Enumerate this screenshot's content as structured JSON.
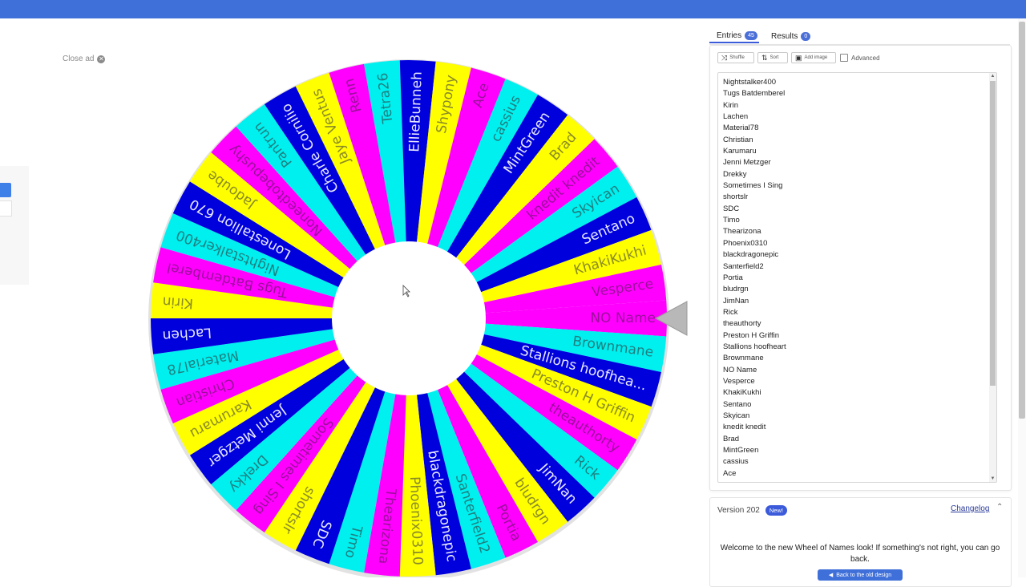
{
  "close_ad": "Close ad",
  "tabs": {
    "entries_label": "Entries",
    "entries_count": "45",
    "results_label": "Results",
    "results_count": "0"
  },
  "toolbar": {
    "shuffle": "Shuffle",
    "sort": "Sort",
    "add_image": "Add image",
    "advanced": "Advanced"
  },
  "entries": [
    "Nightstalker400",
    "Tugs Batdemberel",
    "Kirin",
    "Lachen",
    "Material78",
    "Christian",
    "Karumaru",
    "Jenni Metzger",
    "Drekky",
    "Sometimes I Sing",
    "shortslr",
    "SDC",
    "Timo",
    "Thearizona",
    "Phoenix0310",
    "blackdragonepic",
    "Santerfield2",
    "Portia",
    "bludrgn",
    "JimNan",
    "Rick",
    "theauthorty",
    "Preston H Griffin",
    "Stallions hoofheart",
    "Brownmane",
    "NO Name",
    "Vesperce",
    "KhakiKukhi",
    "Sentano",
    "Skyican",
    "knedit knedit",
    "Brad",
    "MintGreen",
    "cassius",
    "Ace"
  ],
  "wheel": {
    "segments": [
      "NO Name",
      "Brownmane",
      "Stallions hoofhea...",
      "Preston H Griffin",
      "theauthorty",
      "Rick",
      "JimNan",
      "bludrgn",
      "Portia",
      "Santerfield2",
      "blackdragonepic",
      "Phoenix0310",
      "Thearizona",
      "Timo",
      "SDC",
      "shortslr",
      "Sometimes I Sing",
      "Drekky",
      "Jenni Metzger",
      "Karumaru",
      "Christian",
      "Material78",
      "Lachen",
      "Kirin",
      "Tugs Batdemberel",
      "Nightstalker400",
      "Lonestallion 670",
      "Jadoube",
      "Noneedtobepushy",
      "Pantrun",
      "Charle Cornilio",
      "Jaye Ventus",
      "Renn",
      "Tetra26",
      "EllieBunneh",
      "Shypony",
      "Ace",
      "cassius",
      "MintGreen",
      "Brad",
      "knedit knedit",
      "Skyican",
      "Sentano",
      "KhakiKukhi",
      "Vesperce"
    ],
    "colors": [
      "#ff00ff",
      "#00f0f0",
      "#0000dd",
      "#ffff00"
    ],
    "text_colors": {
      "#ff00ff": "#9a109a",
      "#00f0f0": "#1f7f7f",
      "#0000dd": "#e8e8ff",
      "#ffff00": "#8a8a28"
    }
  },
  "version": {
    "title": "Version 202",
    "badge": "New!",
    "changelog": "Changelog",
    "welcome": "Welcome to the new Wheel of Names look! If something's not right, you can go back.",
    "button": "Back to the old design"
  }
}
